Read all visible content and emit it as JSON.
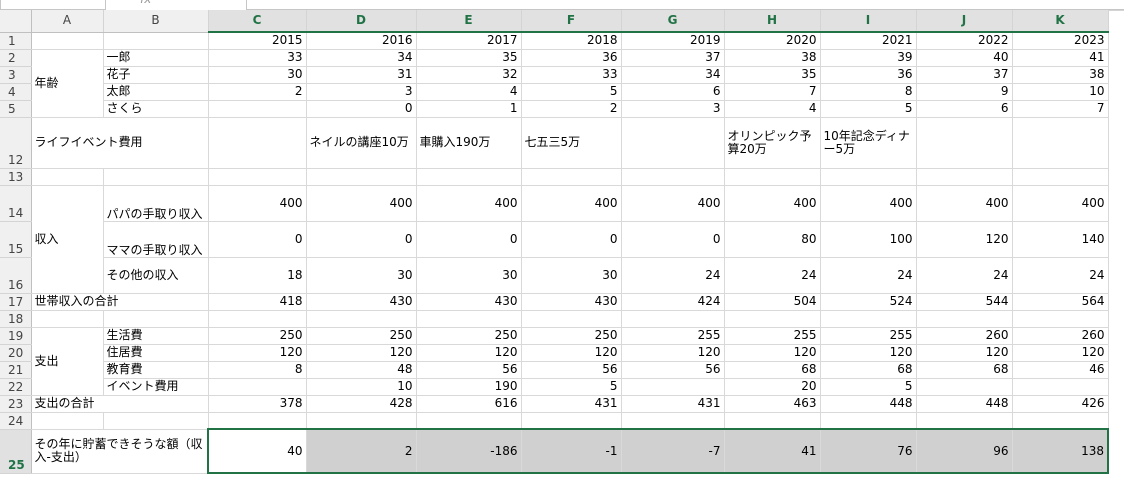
{
  "formula_bar": {
    "fx": "fx"
  },
  "columns": [
    "A",
    "B",
    "C",
    "D",
    "E",
    "F",
    "G",
    "H",
    "I",
    "J",
    "K"
  ],
  "rows": {
    "r1": {
      "num": "1",
      "years": [
        "2015",
        "2016",
        "2017",
        "2018",
        "2019",
        "2020",
        "2021",
        "2022",
        "2023"
      ]
    },
    "r2": {
      "num": "2",
      "section": "年齢",
      "name": "一郎",
      "values": [
        "33",
        "34",
        "35",
        "36",
        "37",
        "38",
        "39",
        "40",
        "41"
      ]
    },
    "r3": {
      "num": "3",
      "name": "花子",
      "values": [
        "30",
        "31",
        "32",
        "33",
        "34",
        "35",
        "36",
        "37",
        "38"
      ]
    },
    "r4": {
      "num": "4",
      "name": "太郎",
      "values": [
        "2",
        "3",
        "4",
        "5",
        "6",
        "7",
        "8",
        "9",
        "10"
      ]
    },
    "r5": {
      "num": "5",
      "name": "さくら",
      "values": [
        "",
        "0",
        "1",
        "2",
        "3",
        "4",
        "5",
        "6",
        "7"
      ]
    },
    "r12": {
      "num": "12",
      "label": "ライフイベント費用",
      "events": [
        "",
        "ネイルの講座10万",
        "車購入190万",
        "七五三5万",
        "",
        "オリンピック予算20万",
        "10年記念ディナー5万",
        "",
        ""
      ]
    },
    "r13": {
      "num": "13"
    },
    "r14": {
      "num": "14",
      "name": "パパの手取り収入",
      "values": [
        "400",
        "400",
        "400",
        "400",
        "400",
        "400",
        "400",
        "400",
        "400"
      ]
    },
    "r15": {
      "num": "15",
      "section": "収入",
      "name": "ママの手取り収入",
      "values": [
        "0",
        "0",
        "0",
        "0",
        "0",
        "80",
        "100",
        "120",
        "140"
      ]
    },
    "r16": {
      "num": "16",
      "name": "その他の収入",
      "values": [
        "18",
        "30",
        "30",
        "30",
        "24",
        "24",
        "24",
        "24",
        "24"
      ]
    },
    "r17": {
      "num": "17",
      "label": "世帯収入の合計",
      "values": [
        "418",
        "430",
        "430",
        "430",
        "424",
        "504",
        "524",
        "544",
        "564"
      ]
    },
    "r18": {
      "num": "18"
    },
    "r19": {
      "num": "19",
      "name": "生活費",
      "values": [
        "250",
        "250",
        "250",
        "250",
        "255",
        "255",
        "255",
        "260",
        "260"
      ]
    },
    "r20": {
      "num": "20",
      "name": "住居費",
      "values": [
        "120",
        "120",
        "120",
        "120",
        "120",
        "120",
        "120",
        "120",
        "120"
      ]
    },
    "r21": {
      "num": "21",
      "section": "支出",
      "name": "教育費",
      "values": [
        "8",
        "48",
        "56",
        "56",
        "56",
        "68",
        "68",
        "68",
        "46"
      ]
    },
    "r22": {
      "num": "22",
      "name": "イベント費用",
      "values": [
        "",
        "10",
        "190",
        "5",
        "",
        "20",
        "5",
        "",
        ""
      ]
    },
    "r23": {
      "num": "23",
      "label": "支出の合計",
      "values": [
        "378",
        "428",
        "616",
        "431",
        "431",
        "463",
        "448",
        "448",
        "426"
      ]
    },
    "r24": {
      "num": "24"
    },
    "r25": {
      "num": "25",
      "label": "その年に貯蓄できそうな額（収入-支出）",
      "values": [
        "40",
        "2",
        "-186",
        "-1",
        "-7",
        "41",
        "76",
        "96",
        "138"
      ]
    }
  }
}
